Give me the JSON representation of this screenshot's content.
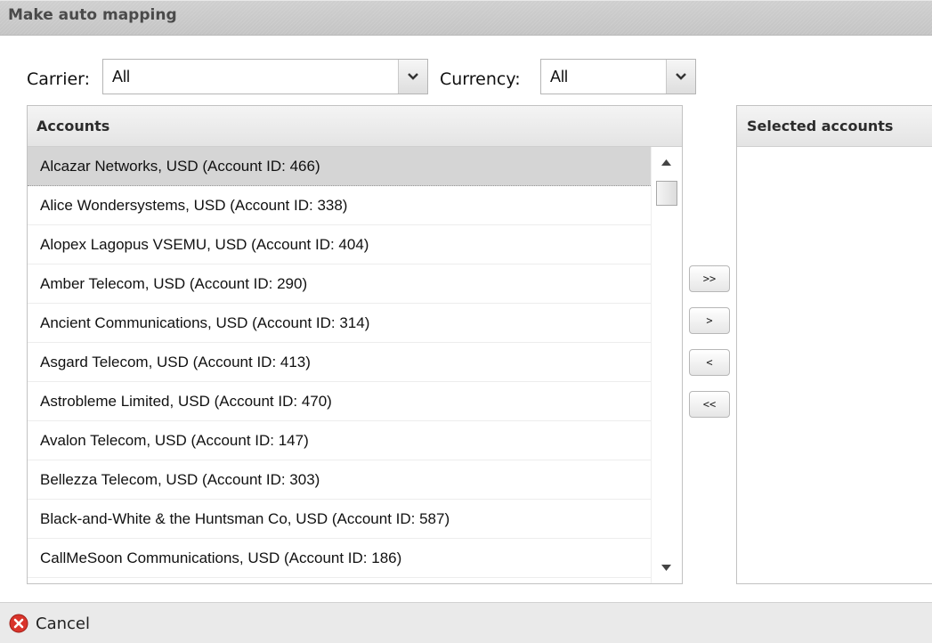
{
  "dialog": {
    "title": "Make auto mapping"
  },
  "filters": {
    "carrier_label": "Carrier:",
    "carrier_value": "All",
    "currency_label": "Currency:",
    "currency_value": "All"
  },
  "accounts": {
    "header": "Accounts",
    "items": [
      "Alcazar Networks, USD (Account ID: 466)",
      "Alice Wondersystems, USD (Account ID: 338)",
      "Alopex Lagopus VSEMU, USD (Account ID: 404)",
      "Amber Telecom, USD (Account ID: 290)",
      "Ancient Communications, USD (Account ID: 314)",
      "Asgard Telecom, USD (Account ID: 413)",
      "Astrobleme Limited, USD (Account ID: 470)",
      "Avalon Telecom, USD (Account ID: 147)",
      "Bellezza Telecom, USD (Account ID: 303)",
      "Black-and-White & the Huntsman Co, USD (Account ID: 587)",
      "CallMeSoon Communications, USD (Account ID: 186)"
    ],
    "selected_index": 0
  },
  "move_buttons": {
    "add_all": ">>",
    "add": ">",
    "remove": "<",
    "remove_all": "<<"
  },
  "selected_accounts": {
    "header": "Selected accounts"
  },
  "footer": {
    "cancel_label": "Cancel"
  },
  "colors": {
    "title_bar": "#c9c9c9",
    "selected_row": "#d5d5d5",
    "cancel_icon": "#d9342b"
  },
  "icons": {
    "dropdown": "chevron-down-icon",
    "scroll_up": "arrow-up-icon",
    "scroll_down": "arrow-down-icon",
    "cancel": "cancel-icon"
  }
}
